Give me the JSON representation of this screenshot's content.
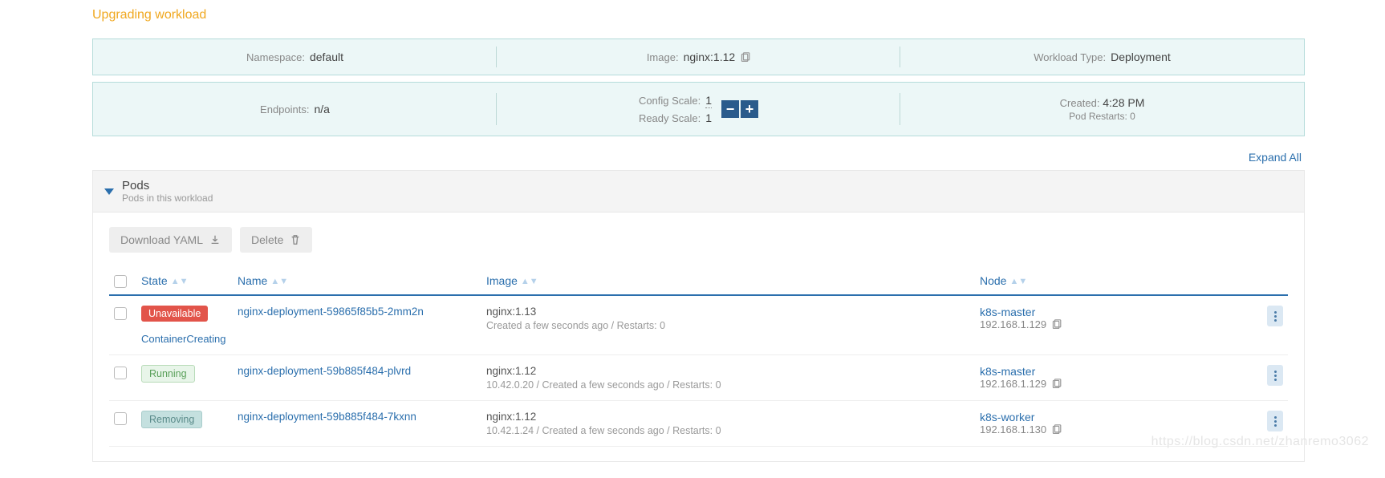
{
  "title": "Upgrading workload",
  "info1": {
    "namespace_lbl": "Namespace:",
    "namespace_val": "default",
    "image_lbl": "Image:",
    "image_val": "nginx:1.12",
    "wtype_lbl": "Workload Type:",
    "wtype_val": "Deployment"
  },
  "info2": {
    "endpoints_lbl": "Endpoints:",
    "endpoints_val": "n/a",
    "config_lbl": "Config Scale:",
    "config_val": "1",
    "ready_lbl": "Ready Scale:",
    "ready_val": "1",
    "minus": "−",
    "plus": "+",
    "created_lbl": "Created:",
    "created_val": "4:28 PM",
    "restarts": "Pod Restarts: 0"
  },
  "expand": "Expand All",
  "section": {
    "title": "Pods",
    "sub": "Pods in this workload"
  },
  "actions": {
    "download": "Download YAML",
    "delete": "Delete"
  },
  "cols": {
    "state": "State",
    "name": "Name",
    "image": "Image",
    "node": "Node"
  },
  "rows": [
    {
      "badge": "Unavailable",
      "badgecls": "b-red",
      "name": "nginx-deployment-59865f85b5-2mm2n",
      "sub": "ContainerCreating",
      "image": "nginx:1.13",
      "imgmeta": "Created a few seconds ago / Restarts: 0",
      "node": "k8s-master",
      "ip": "192.168.1.129"
    },
    {
      "badge": "Running",
      "badgecls": "b-green",
      "name": "nginx-deployment-59b885f484-plvrd",
      "sub": "",
      "image": "nginx:1.12",
      "imgmeta": "10.42.0.20 / Created a few seconds ago / Restarts: 0",
      "node": "k8s-master",
      "ip": "192.168.1.129"
    },
    {
      "badge": "Removing",
      "badgecls": "b-teal",
      "name": "nginx-deployment-59b885f484-7kxnn",
      "sub": "",
      "image": "nginx:1.12",
      "imgmeta": "10.42.1.24 / Created a few seconds ago / Restarts: 0",
      "node": "k8s-worker",
      "ip": "192.168.1.130"
    }
  ],
  "watermark": "https://blog.csdn.net/zhanremo3062"
}
